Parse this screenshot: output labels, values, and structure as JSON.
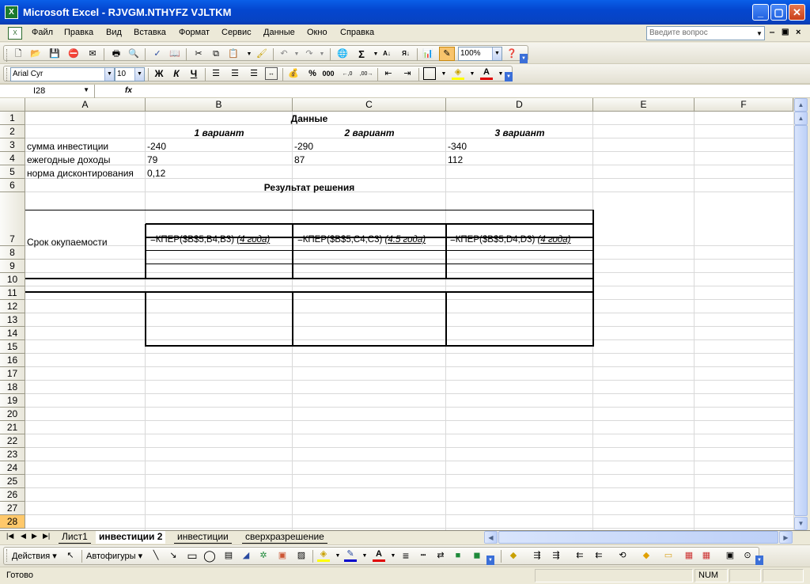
{
  "window": {
    "title": "Microsoft Excel - RJVGM.NTHYFZ VJLTKM",
    "app_icon": "X"
  },
  "menu": {
    "items": [
      {
        "label": "Файл",
        "u": "Ф"
      },
      {
        "label": "Правка",
        "u": "П"
      },
      {
        "label": "Вид",
        "u": "В"
      },
      {
        "label": "Вставка",
        "u": "с"
      },
      {
        "label": "Формат",
        "u": "о"
      },
      {
        "label": "Сервис",
        "u": "С"
      },
      {
        "label": "Данные",
        "u": "Д"
      },
      {
        "label": "Окно",
        "u": "О"
      },
      {
        "label": "Справка",
        "u": "С"
      }
    ],
    "ask_placeholder": "Введите вопрос"
  },
  "toolbar_standard": {
    "zoom": "100%"
  },
  "toolbar_format": {
    "font": "Arial Cyr",
    "size": "10",
    "bold": "Ж",
    "italic": "К",
    "underline": "Ч",
    "percent": "%",
    "thousands": "000",
    "inc_decimal": ",0\n,00",
    "font_color_letter": "A"
  },
  "formula_bar": {
    "cell_ref": "I28",
    "fx": "fx",
    "content": ""
  },
  "sheet": {
    "columns": [
      "A",
      "B",
      "C",
      "D",
      "E",
      "F"
    ],
    "rows": [
      "1",
      "2",
      "3",
      "4",
      "5",
      "6",
      "7",
      "8",
      "9",
      "10",
      "11",
      "12",
      "13",
      "14",
      "15",
      "16",
      "17",
      "18",
      "19",
      "20",
      "21",
      "22",
      "23",
      "24",
      "25",
      "26",
      "27",
      "28"
    ],
    "selected_row": "28",
    "cells": {
      "a1": "Данные",
      "b2": "1 вариант",
      "c2": "2 вариант",
      "d2": "3 вариант",
      "a3": "сумма инвестиции",
      "b3": "-240",
      "c3": "-290",
      "d3": "-340",
      "a4": "ежегодные доходы",
      "b4": "79",
      "c4": "87",
      "d4": "112",
      "a5": "норма дисконтирования",
      "b5": "0,12",
      "a6": "Результат решения",
      "a7": "Срок окупаемости",
      "b7_formula": "=КПЕР($B$5;B4;B3)",
      "b7_note": "(4 года)",
      "c7_formula": "=КПЕР($B$5;C4;C3)",
      "c7_note": "(4.5 года)",
      "d7_formula": "=КПЕР($B$5;D4;D3)",
      "d7_note": "(4 года)"
    }
  },
  "tabs": {
    "items": [
      "Лист1",
      "инвестиции 2",
      "инвестиции",
      "сверхразрешение"
    ],
    "active": "инвестиции 2"
  },
  "drawing": {
    "actions": "Действия",
    "autoshapes": "Автофигуры"
  },
  "status": {
    "text": "Готово",
    "num": "NUM"
  },
  "colors": {
    "title_bar": "#0a5fe8",
    "selected_row_header": "#ffc86a",
    "excel_green": "#1c7a2e"
  }
}
